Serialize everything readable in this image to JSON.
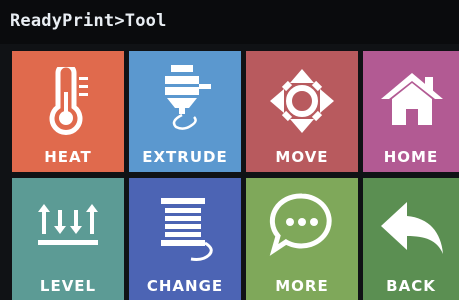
{
  "header": {
    "title": "ReadyPrint>Tool"
  },
  "tiles": [
    {
      "label": "HEAT",
      "color": "#e06a4d",
      "icon": "thermometer-icon"
    },
    {
      "label": "EXTRUDE",
      "color": "#5b98cf",
      "icon": "extruder-icon"
    },
    {
      "label": "MOVE",
      "color": "#b85a5e",
      "icon": "move-arrows-icon"
    },
    {
      "label": "HOME",
      "color": "#b25a93",
      "icon": "house-icon"
    },
    {
      "label": "LEVEL",
      "color": "#5c9b95",
      "icon": "level-arrows-icon"
    },
    {
      "label": "CHANGE",
      "color": "#4c64b4",
      "icon": "filament-spool-icon"
    },
    {
      "label": "MORE",
      "color": "#7fa85a",
      "icon": "chat-bubble-icon"
    },
    {
      "label": "BACK",
      "color": "#5b8f52",
      "icon": "back-arrow-icon"
    }
  ]
}
